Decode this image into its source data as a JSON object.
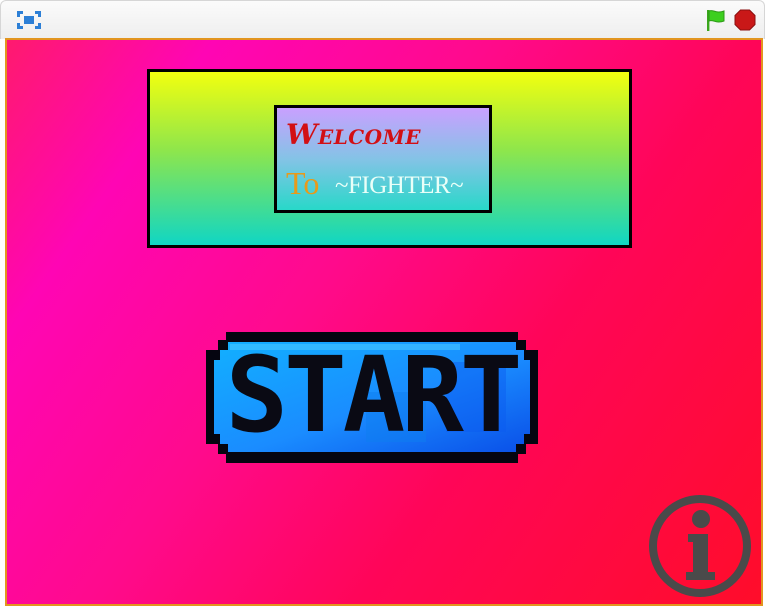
{
  "toolbar": {
    "fullscreen_icon": "fullscreen-icon",
    "green_flag_icon": "green-flag-icon",
    "stop_icon": "stop-sign-icon"
  },
  "stage": {
    "welcome_text": "Welcome",
    "to_text": "To",
    "fighter_text": "~FIGHTER~",
    "start_label": "START",
    "info_icon": "info-icon"
  },
  "colors": {
    "stage_border": "#e2951f",
    "welcome": "#d20f14",
    "to": "#e89a1a",
    "fighter": "#e9fff8",
    "start_fill": "#1a8cff",
    "flag": "#3ccf1e",
    "stop": "#c91818"
  }
}
